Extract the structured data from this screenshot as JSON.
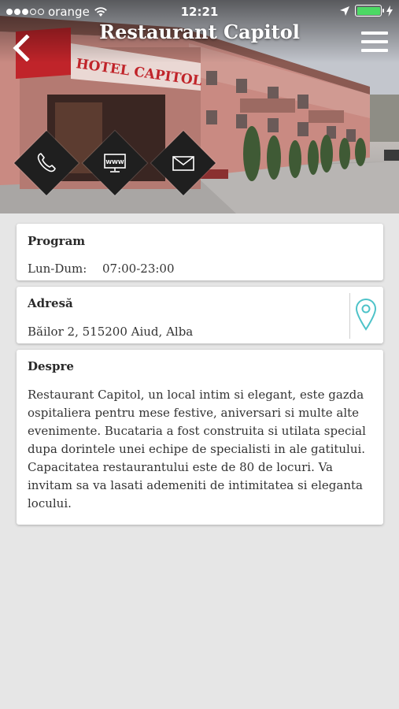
{
  "status_bar": {
    "carrier": "orange",
    "time": "12:21"
  },
  "header": {
    "title": "Restaurant Capitol",
    "hero_sign": "HOTEL CAPITOL"
  },
  "actions": [
    {
      "icon": "phone-icon"
    },
    {
      "icon": "www-icon",
      "label": "WWW"
    },
    {
      "icon": "mail-icon"
    }
  ],
  "program": {
    "title": "Program",
    "days": "Lun-Dum:",
    "hours": "07:00-23:00"
  },
  "address": {
    "title": "Adresă",
    "value": "Băilor 2, 515200 Aiud, Alba"
  },
  "about": {
    "title": "Despre",
    "text": "Restaurant Capitol, un local intim si elegant, este gazda ospitaliera pentru mese festive, aniversari si multe alte evenimente. Bucataria a fost construita si utilata special dupa dorintele unei echipe de specialisti in ale gatitului. Capacitatea restaurantului este de 80 de locuri. Va invitam sa va lasati ademeniti de intimitatea si eleganta locului."
  },
  "colors": {
    "accent_teal": "#4ec3c9",
    "page_bg": "#e6e6e6",
    "diamond": "#1f1f1f",
    "battery": "#4cd964"
  }
}
